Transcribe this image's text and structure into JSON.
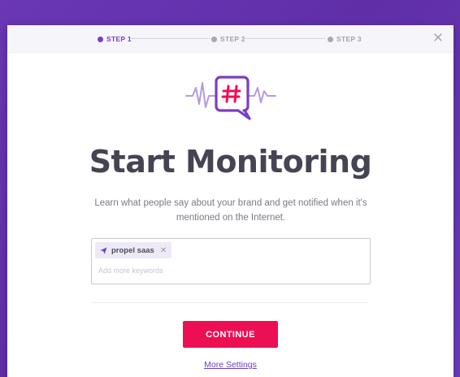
{
  "steps": [
    {
      "label": "STEP 1",
      "active": true
    },
    {
      "label": "STEP 2",
      "active": false
    },
    {
      "label": "STEP 3",
      "active": false
    }
  ],
  "icons": {
    "close": "close-icon",
    "hero": "hashtag-chat-icon",
    "chip": "paper-plane-icon",
    "chip_remove": "close-icon"
  },
  "title": "Start Monitoring",
  "subtitle": "Learn what people say about your brand and get notified when it's mentioned on the Internet.",
  "keywords": {
    "chips": [
      {
        "label": "propel saas"
      }
    ],
    "chip_remove_glyph": "✕",
    "placeholder": "Add more keywords"
  },
  "continue_label": "CONTINUE",
  "more_settings_label": "More Settings",
  "colors": {
    "accent": "#ec0f54",
    "brand": "#7b3cc6",
    "background": "#6a37b5"
  }
}
